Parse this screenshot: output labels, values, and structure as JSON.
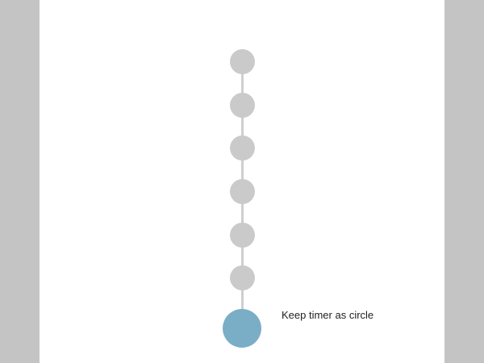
{
  "colors": {
    "side_bar": "#c4c4c4",
    "panel": "#ffffff",
    "step_dot": "#cacaca",
    "connector": "#cfcfcf",
    "timer_accent": "#7aaec7"
  },
  "steps": [
    {
      "state": "inactive"
    },
    {
      "state": "inactive"
    },
    {
      "state": "inactive"
    },
    {
      "state": "inactive"
    },
    {
      "state": "inactive"
    },
    {
      "state": "inactive"
    }
  ],
  "timer": {
    "label": "Keep timer as circle"
  }
}
